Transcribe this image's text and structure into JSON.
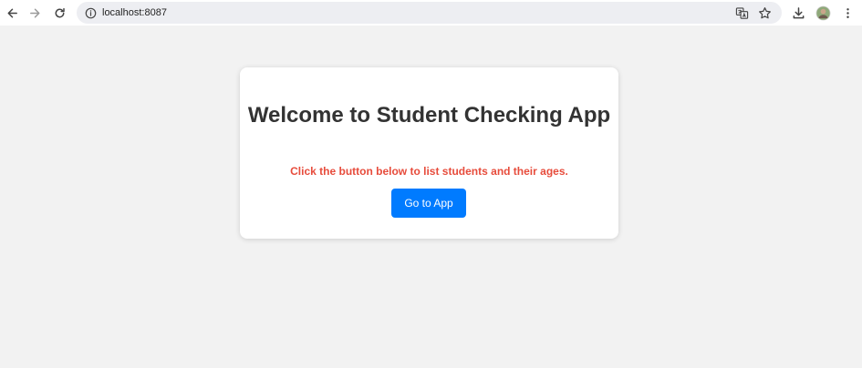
{
  "browser": {
    "url": "localhost:8087",
    "icons": {
      "back": "back-arrow-icon",
      "forward": "forward-arrow-icon",
      "reload": "reload-icon",
      "info": "info-icon",
      "translate": "translate-icon",
      "bookmark": "star-icon",
      "download": "download-icon",
      "profile": "avatar-icon",
      "menu": "kebab-menu-icon"
    }
  },
  "card": {
    "title": "Welcome to Student Checking App",
    "subtitle": "Click the button below to list students and their ages.",
    "button_label": "Go to App"
  },
  "colors": {
    "page_background": "#f2f2f2",
    "card_background": "#ffffff",
    "title": "#333333",
    "subtitle": "#e74c3c",
    "button": "#007bff",
    "button_text": "#ffffff"
  }
}
